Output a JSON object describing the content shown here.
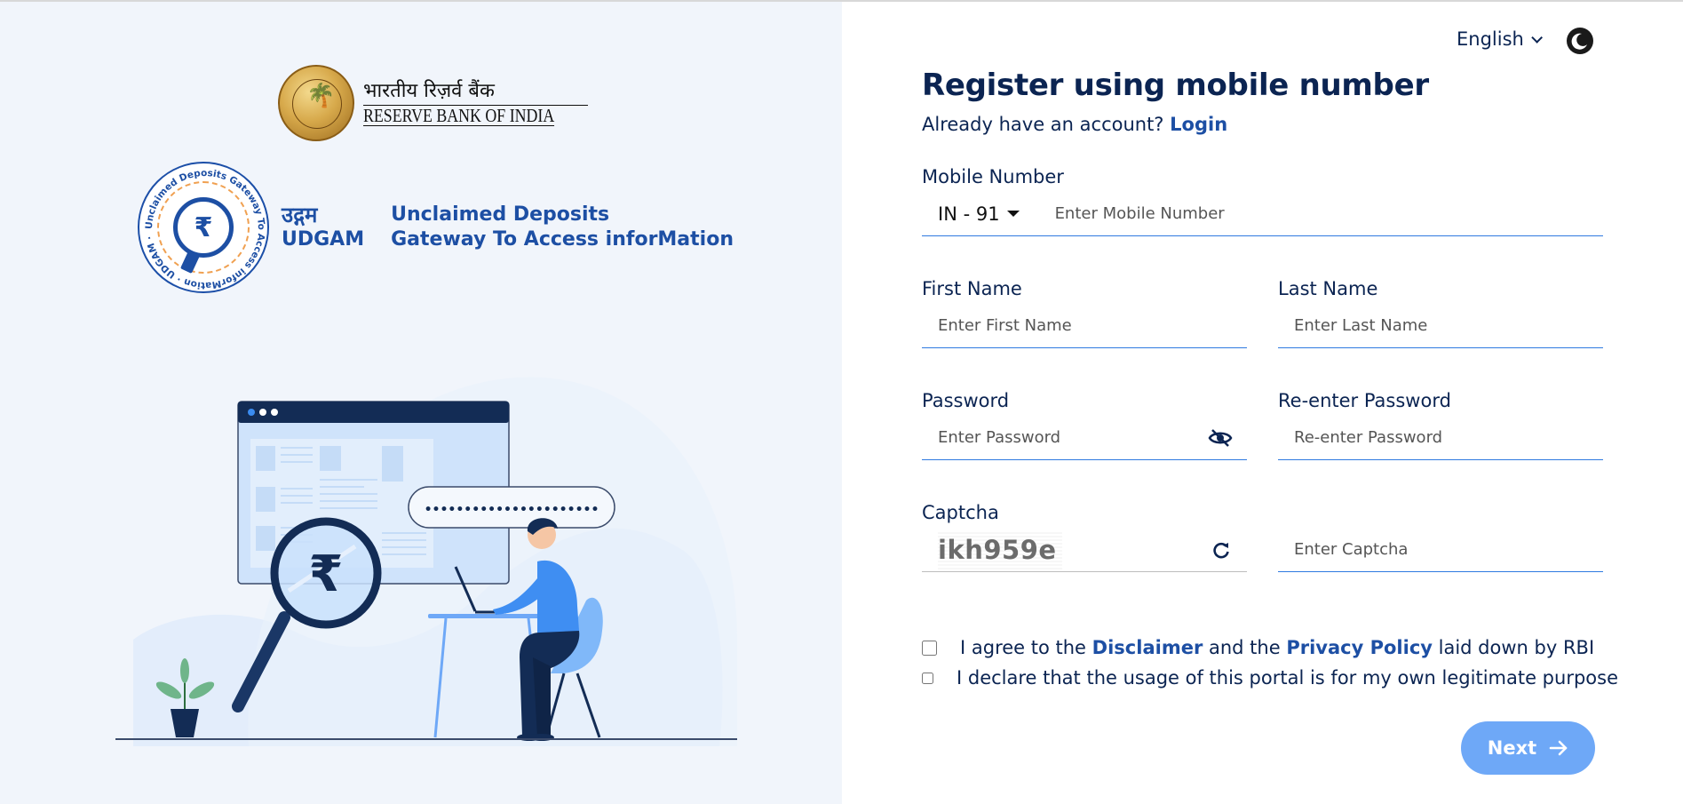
{
  "branding": {
    "rbi_hindi": "भारतीय रिज़र्व बैंक",
    "rbi_english": "RESERVE BANK OF INDIA",
    "udgam_hindi": "उद्गम",
    "udgam_english": "UDGAM",
    "udgam_full_line1": "Unclaimed Deposits",
    "udgam_full_line2": "Gateway To Access inforMation",
    "udgam_seal_text": "Unclaimed Deposits Gateway To Access inforMation · UDGAM ·",
    "rupee_symbol": "₹"
  },
  "header": {
    "language": "English",
    "language_icon": "chevron-down-icon",
    "theme_icon": "moon-icon"
  },
  "form": {
    "title": "Register using mobile number",
    "subtitle_prefix": "Already have an account?",
    "login_link": "Login",
    "mobile": {
      "label": "Mobile Number",
      "country_code": "IN - 91",
      "placeholder": "Enter Mobile Number",
      "value": ""
    },
    "first_name": {
      "label": "First Name",
      "placeholder": "Enter First Name",
      "value": ""
    },
    "last_name": {
      "label": "Last Name",
      "placeholder": "Enter Last Name",
      "value": ""
    },
    "password": {
      "label": "Password",
      "placeholder": "Enter Password",
      "value": "",
      "toggle_icon": "eye-off-icon"
    },
    "reenter_password": {
      "label": "Re-enter Password",
      "placeholder": "Re-enter Password",
      "value": ""
    },
    "captcha": {
      "label": "Captcha",
      "image_text": "ikh959e",
      "refresh_icon": "refresh-icon",
      "placeholder": "Enter Captcha",
      "value": ""
    },
    "agreements": {
      "disclaimer": {
        "prefix": "I agree to the",
        "link1": "Disclaimer",
        "middle": "and the",
        "link2": "Privacy Policy",
        "suffix": "laid down by RBI",
        "checked": false
      },
      "legitimate": {
        "text": "I declare that the usage of this portal is for my own legitimate purpose",
        "checked": false
      }
    },
    "next_label": "Next",
    "next_icon": "arrow-right-icon"
  },
  "illustration": {
    "password_dots": "••••••••••••••••••••••",
    "rupee_symbol": "₹"
  },
  "colors": {
    "primary": "#1d4fa4",
    "heading": "#0b2452",
    "field_underline": "#2f7ae0",
    "next_button": "#6ea8f7",
    "left_panel_bg": "#f1f5fb"
  }
}
